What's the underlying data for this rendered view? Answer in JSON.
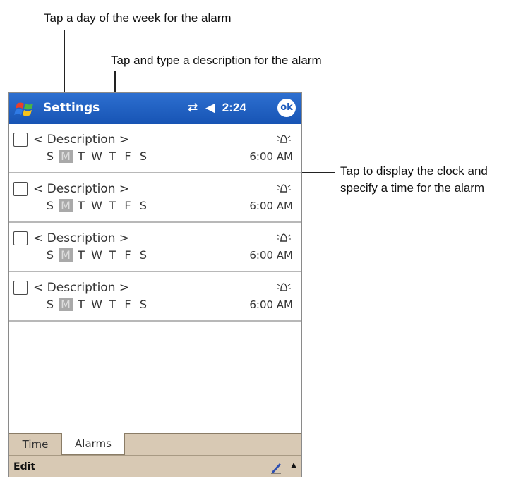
{
  "callouts": {
    "day": "Tap a day of the week for the alarm",
    "description": "Tap and type a description for the alarm",
    "clock_line1": "Tap to display the clock and",
    "clock_line2": "specify a time for the alarm"
  },
  "titlebar": {
    "title": "Settings",
    "time": "2:24",
    "ok_label": "ok"
  },
  "alarms": [
    {
      "description": "< Description >",
      "days": [
        "S",
        "M",
        "T",
        "W",
        "T",
        "F",
        "S"
      ],
      "selected_day": "M",
      "time": "6:00 AM",
      "checked": false
    },
    {
      "description": "< Description >",
      "days": [
        "S",
        "M",
        "T",
        "W",
        "T",
        "F",
        "S"
      ],
      "selected_day": "M",
      "time": "6:00 AM",
      "checked": false
    },
    {
      "description": "< Description >",
      "days": [
        "S",
        "M",
        "T",
        "W",
        "T",
        "F",
        "S"
      ],
      "selected_day": "M",
      "time": "6:00 AM",
      "checked": false
    },
    {
      "description": "< Description >",
      "days": [
        "S",
        "M",
        "T",
        "W",
        "T",
        "F",
        "S"
      ],
      "selected_day": "M",
      "time": "6:00 AM",
      "checked": false
    }
  ],
  "tabs": [
    "Time",
    "Alarms"
  ],
  "active_tab": "Alarms",
  "menubar": {
    "edit_label": "Edit"
  },
  "colors": {
    "titlebar": "#1d5bbd",
    "tabstrip": "#d8c9b4",
    "selected_day": "#a9a9a9"
  },
  "icons": {
    "start": "windows-flag-icon",
    "connectivity": "connectivity-icon",
    "volume": "speaker-icon",
    "alarm": "alarm-bell-icon",
    "pen": "pen-icon",
    "sip": "up-arrow-icon"
  }
}
